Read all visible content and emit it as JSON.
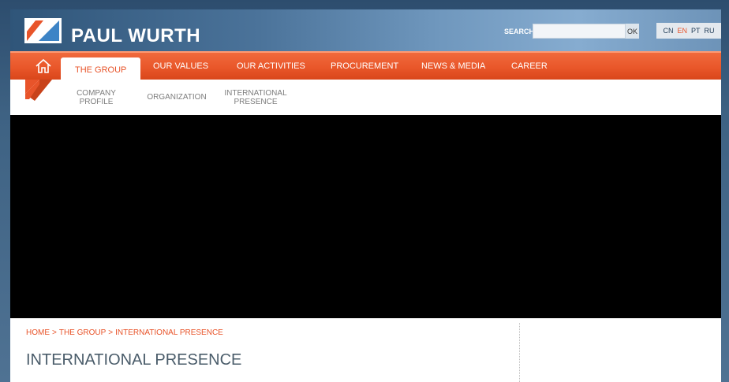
{
  "brand": {
    "name": "PAUL WURTH"
  },
  "search": {
    "label": "SEARCH",
    "value": "",
    "placeholder": "",
    "ok_label": "OK"
  },
  "languages": [
    {
      "code": "CN",
      "active": false
    },
    {
      "code": "EN",
      "active": true
    },
    {
      "code": "PT",
      "active": false
    },
    {
      "code": "RU",
      "active": false
    }
  ],
  "nav": {
    "home_icon": "house-icon",
    "items": [
      {
        "label": "THE GROUP",
        "active": true
      },
      {
        "label": "OUR VALUES"
      },
      {
        "label": "OUR ACTIVITIES"
      },
      {
        "label": "PROCUREMENT"
      },
      {
        "label": "NEWS & MEDIA"
      },
      {
        "label": "CAREER"
      }
    ]
  },
  "subnav": {
    "items": [
      {
        "line1": "COMPANY",
        "line2": "PROFILE"
      },
      {
        "line1": "ORGANIZATION",
        "line2": ""
      },
      {
        "line1": "INTERNATIONAL",
        "line2": "PRESENCE"
      }
    ]
  },
  "breadcrumb": {
    "items": [
      "HOME",
      "THE GROUP",
      "INTERNATIONAL PRESENCE"
    ],
    "separator": ">"
  },
  "page": {
    "title": "INTERNATIONAL PRESENCE"
  },
  "colors": {
    "accent": "#e8542a",
    "header_blue": "#4b739a",
    "text": "#4a5c6a"
  }
}
